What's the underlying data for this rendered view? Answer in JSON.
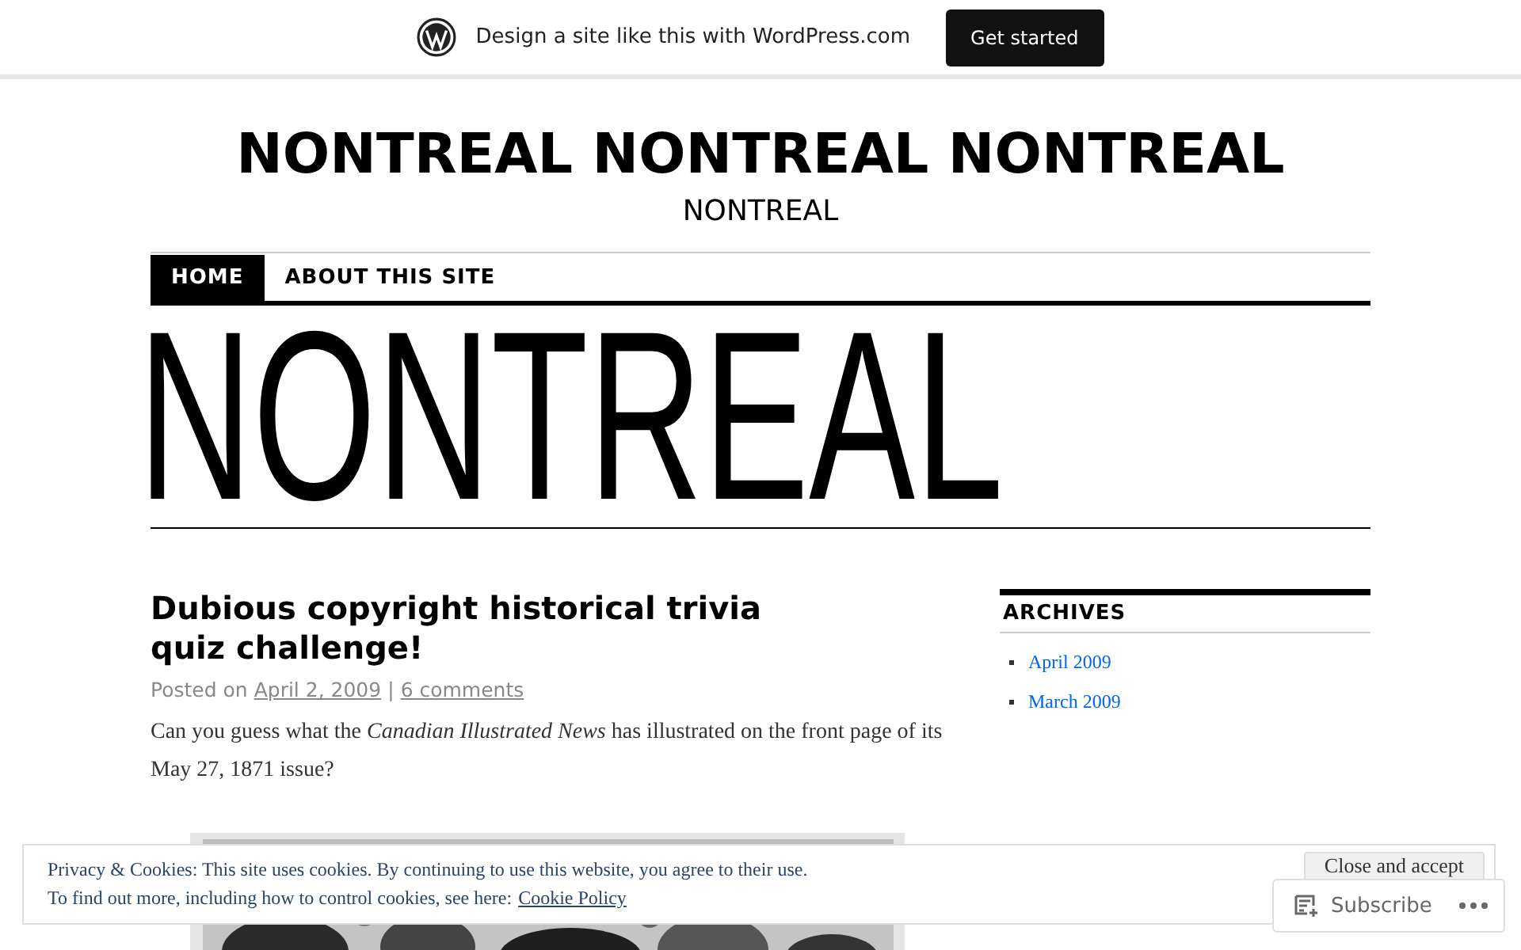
{
  "promo_bar": {
    "text": "Design a site like this with WordPress.com",
    "button": "Get started"
  },
  "site": {
    "title": "NONTREAL NONTREAL NONTREAL",
    "tagline": "NONTREAL"
  },
  "nav": [
    {
      "label": "HOME",
      "selected": true
    },
    {
      "label": "ABOUT THIS SITE",
      "selected": false
    }
  ],
  "header_image_text": "NONTREAL",
  "post": {
    "title": "Dubious copyright historical trivia quiz challenge!",
    "posted_on": "Posted on",
    "date": "April 2, 2009",
    "separator": "|",
    "comments": "6 comments",
    "body": "Can you guess what the *Canadian Illustrated News* has illustrated on the front page of its May 27, 1871 issue?"
  },
  "sidebar": {
    "heading": "ARCHIVES",
    "links": [
      "April 2009",
      "March 2009"
    ]
  },
  "cookie_banner": {
    "line_1": "Privacy & Cookies: This site uses cookies. By continuing to use this website, you agree to their use.",
    "line_2": "To find out more, including how to control cookies, see here:",
    "link": "Cookie Policy",
    "button": "Close and accept"
  },
  "subscribe_bar": {
    "label": "Subscribe"
  }
}
